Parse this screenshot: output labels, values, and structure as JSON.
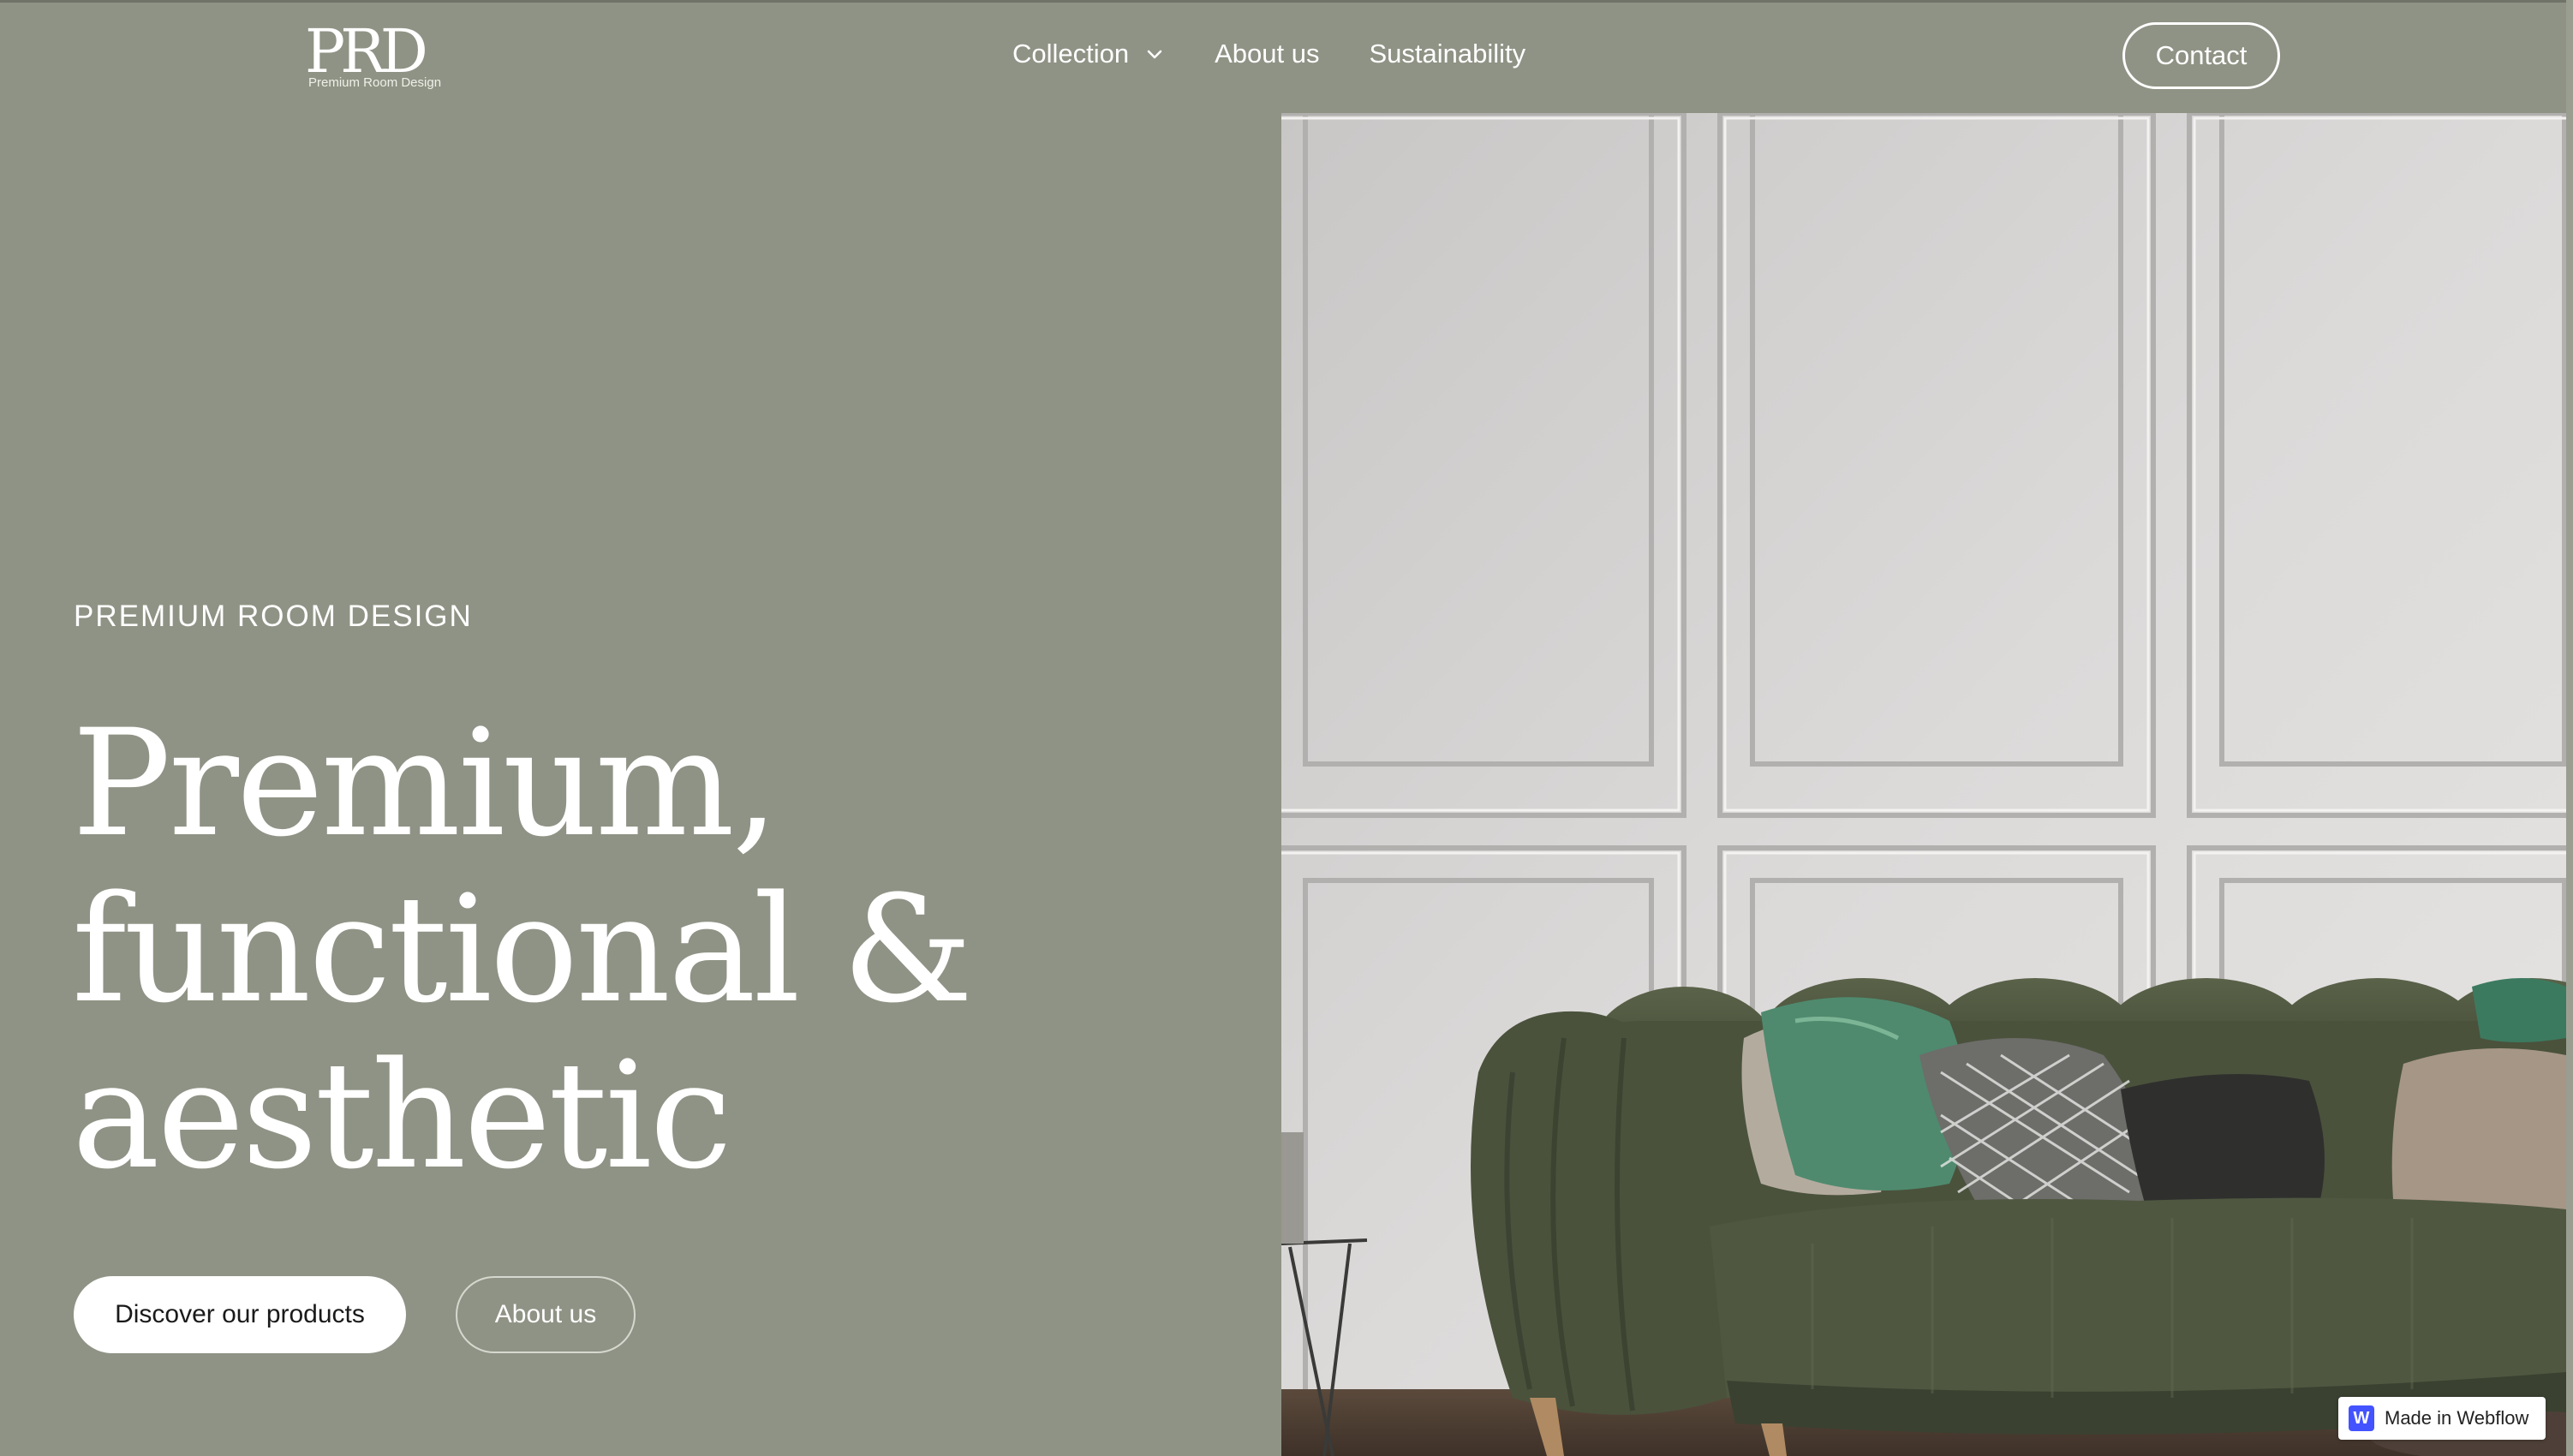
{
  "nav": {
    "logo": {
      "mark": "PRD",
      "subtitle": "Premium Room Design"
    },
    "links": [
      {
        "label": "Collection",
        "icon": "chevron-down-icon"
      },
      {
        "label": "About us"
      },
      {
        "label": "Sustainability"
      }
    ],
    "contact_label": "Contact"
  },
  "hero": {
    "eyebrow": "PREMIUM ROOM DESIGN",
    "headline_lines": [
      "Premium,",
      "functional &",
      "aesthetic"
    ],
    "primary_button": "Discover our products",
    "secondary_button": "About us",
    "image": "living-room-sofa-photo"
  },
  "badge": {
    "icon": "webflow-logo-icon",
    "icon_letter": "W",
    "label": "Made in Webflow"
  },
  "colors": {
    "background": "#8f9385",
    "text": "#ffffff",
    "primary_button_bg": "#ffffff",
    "primary_button_text": "#1a1a1a",
    "sofa": "#4d5540",
    "webflow_blue": "#4353ff"
  }
}
